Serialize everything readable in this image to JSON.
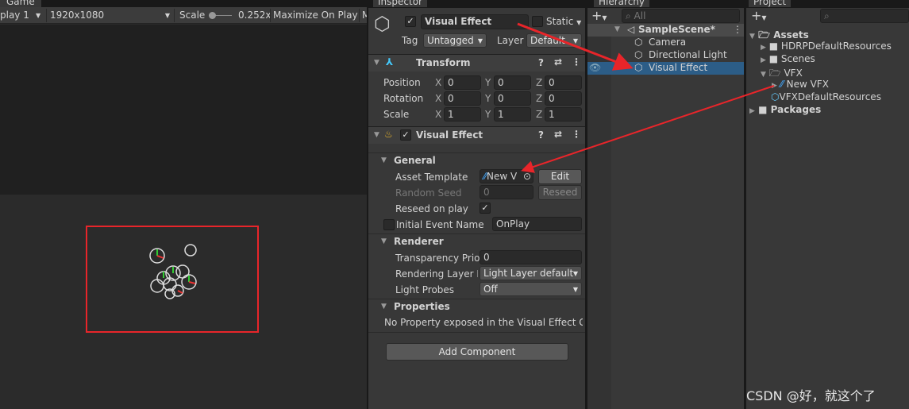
{
  "game": {
    "tab": "Game",
    "display": "play 1",
    "resolution": "1920x1080",
    "scale_label": "Scale",
    "scale_value": "0.252x",
    "maximize": "Maximize On Play",
    "more": "M"
  },
  "inspector": {
    "tab": "Inspector",
    "object_name": "Visual Effect",
    "active": true,
    "static_label": "Static",
    "tag_label": "Tag",
    "tag_value": "Untagged",
    "layer_label": "Layer",
    "layer_value": "Default",
    "transform": {
      "title": "Transform",
      "rows": [
        {
          "label": "Position",
          "x": "0",
          "y": "0",
          "z": "0"
        },
        {
          "label": "Rotation",
          "x": "0",
          "y": "0",
          "z": "0"
        },
        {
          "label": "Scale",
          "x": "1",
          "y": "1",
          "z": "1"
        }
      ]
    },
    "vfx": {
      "title": "Visual Effect",
      "general": "General",
      "asset_template_label": "Asset Template",
      "asset_template_value": "New V",
      "edit": "Edit",
      "random_seed_label": "Random Seed",
      "random_seed_value": "0",
      "reseed": "Reseed",
      "reseed_on_play_label": "Reseed on play",
      "reseed_on_play": true,
      "initial_event_label": "Initial Event Name",
      "initial_event_value": "OnPlay",
      "initial_event_enabled": false,
      "renderer": "Renderer",
      "transparency_label": "Transparency Prio",
      "transparency_value": "0",
      "rendering_layer_label": "Rendering Layer M",
      "rendering_layer_value": "Light Layer default",
      "light_probes_label": "Light Probes",
      "light_probes_value": "Off",
      "properties": "Properties",
      "no_property": "No Property exposed in the Visual Effect Gra"
    },
    "add_component": "Add Component"
  },
  "hierarchy": {
    "tab": "Hierarchy",
    "search_placeholder": "All",
    "scene": "SampleScene*",
    "items": [
      "Camera",
      "Directional Light",
      "Visual Effect"
    ],
    "selected": "Visual Effect"
  },
  "project": {
    "tab": "Project",
    "assets": "Assets",
    "children": [
      "HDRPDefaultResources",
      "Scenes",
      "VFX"
    ],
    "vfx_children": [
      "New VFX",
      "VFXDefaultResources"
    ],
    "packages": "Packages"
  },
  "watermark": "CSDN @好，就这个了",
  "colors": {
    "selection": "#2c5d87",
    "annotation": "#e8252a"
  }
}
